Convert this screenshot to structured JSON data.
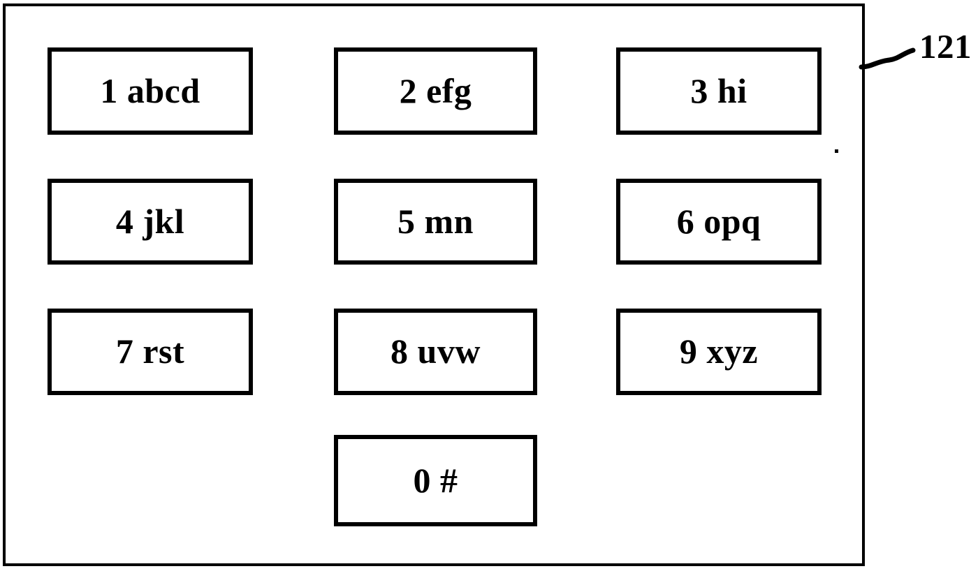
{
  "figure": {
    "reference_numeral": "121",
    "description": "Telephone keypad layout diagram"
  },
  "keypad": {
    "keys": [
      {
        "id": "key-1",
        "label": "1 abcd",
        "digit": "1",
        "letters": "abcd",
        "row": 1,
        "col": 1
      },
      {
        "id": "key-2",
        "label": "2 efg",
        "digit": "2",
        "letters": "efg",
        "row": 1,
        "col": 2
      },
      {
        "id": "key-3",
        "label": "3 hi",
        "digit": "3",
        "letters": "hi",
        "row": 1,
        "col": 3
      },
      {
        "id": "key-4",
        "label": "4 jkl",
        "digit": "4",
        "letters": "jkl",
        "row": 2,
        "col": 1
      },
      {
        "id": "key-5",
        "label": "5 mn",
        "digit": "5",
        "letters": "mn",
        "row": 2,
        "col": 2
      },
      {
        "id": "key-6",
        "label": "6 opq",
        "digit": "6",
        "letters": "opq",
        "row": 2,
        "col": 3
      },
      {
        "id": "key-7",
        "label": "7 rst",
        "digit": "7",
        "letters": "rst",
        "row": 3,
        "col": 1
      },
      {
        "id": "key-8",
        "label": "8 uvw",
        "digit": "8",
        "letters": "uvw",
        "row": 3,
        "col": 2
      },
      {
        "id": "key-9",
        "label": "9 xyz",
        "digit": "9",
        "letters": "xyz",
        "row": 3,
        "col": 3
      },
      {
        "id": "key-0",
        "label": "0 #",
        "digit": "0",
        "letters": "#",
        "row": 4,
        "col": 2
      }
    ]
  },
  "colors": {
    "ink": "#000000",
    "paper": "#ffffff"
  }
}
